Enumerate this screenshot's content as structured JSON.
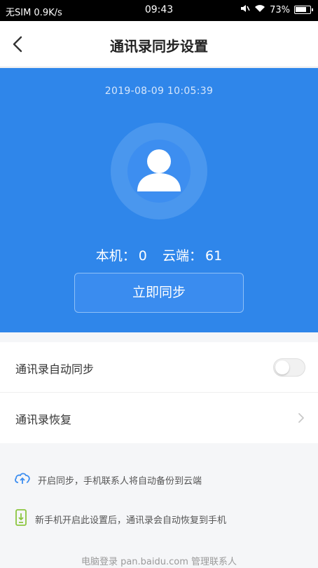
{
  "status_bar": {
    "carrier": "无SIM 0.9K/s",
    "time": "09:43",
    "battery": "73%"
  },
  "nav": {
    "title": "通讯录同步设置"
  },
  "hero": {
    "timestamp": "2019-08-09  10:05:39",
    "local_label": "本机：",
    "local_count": "0",
    "cloud_label": "云端：",
    "cloud_count": "61",
    "sync_button": "立即同步"
  },
  "settings": {
    "auto_sync_label": "通讯录自动同步",
    "auto_sync_on": false,
    "restore_label": "通讯录恢复"
  },
  "tips": {
    "tip1": "开启同步，手机联系人将自动备份到云端",
    "tip2": "新手机开启此设置后，通讯录会自动恢复到手机"
  },
  "footer": {
    "text": "电脑登录 pan.baidu.com 管理联系人"
  },
  "colors": {
    "accent": "#2f86ea",
    "tip_icon_blue": "#3d8ef0",
    "tip_icon_green": "#8cc63f"
  }
}
